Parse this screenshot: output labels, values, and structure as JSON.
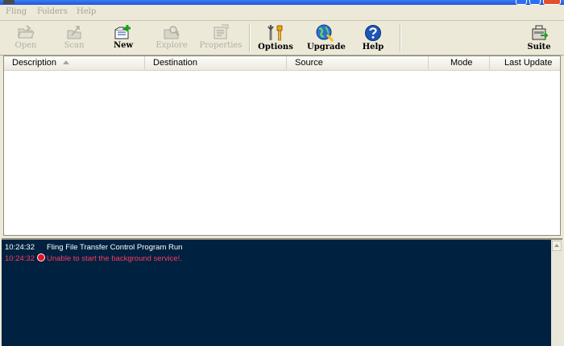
{
  "colors": {
    "accent": "#1e56d8",
    "log_background": "#00213f",
    "log_info": "#ffffff",
    "log_error": "#ff3b5f"
  },
  "menu": {
    "items": [
      "Fling",
      "Folders",
      "Help"
    ]
  },
  "toolbar": {
    "buttons": [
      {
        "label": "Open",
        "icon": "folder-open-icon",
        "enabled": false
      },
      {
        "label": "Scan",
        "icon": "scan-icon",
        "enabled": false
      },
      {
        "label": "New",
        "icon": "new-folder-icon",
        "enabled": true
      },
      {
        "label": "Explore",
        "icon": "explore-icon",
        "enabled": false
      },
      {
        "label": "Properties",
        "icon": "properties-icon",
        "enabled": false
      },
      {
        "label": "Options",
        "icon": "options-icon",
        "enabled": true
      },
      {
        "label": "Upgrade",
        "icon": "upgrade-globe-icon",
        "enabled": true
      },
      {
        "label": "Help",
        "icon": "help-icon",
        "enabled": true
      },
      {
        "label": "Suite",
        "icon": "suite-icon",
        "enabled": true
      }
    ]
  },
  "table": {
    "columns": [
      "Description",
      "Destination",
      "Source",
      "Mode",
      "Last Update"
    ],
    "sort_column": "Description",
    "rows": []
  },
  "log": [
    {
      "time": "10:24:32",
      "message": "Fling File Transfer Control Program Run",
      "level": "info"
    },
    {
      "time": "10:24:32",
      "message": "Unable to start the background service!.",
      "level": "error"
    }
  ]
}
